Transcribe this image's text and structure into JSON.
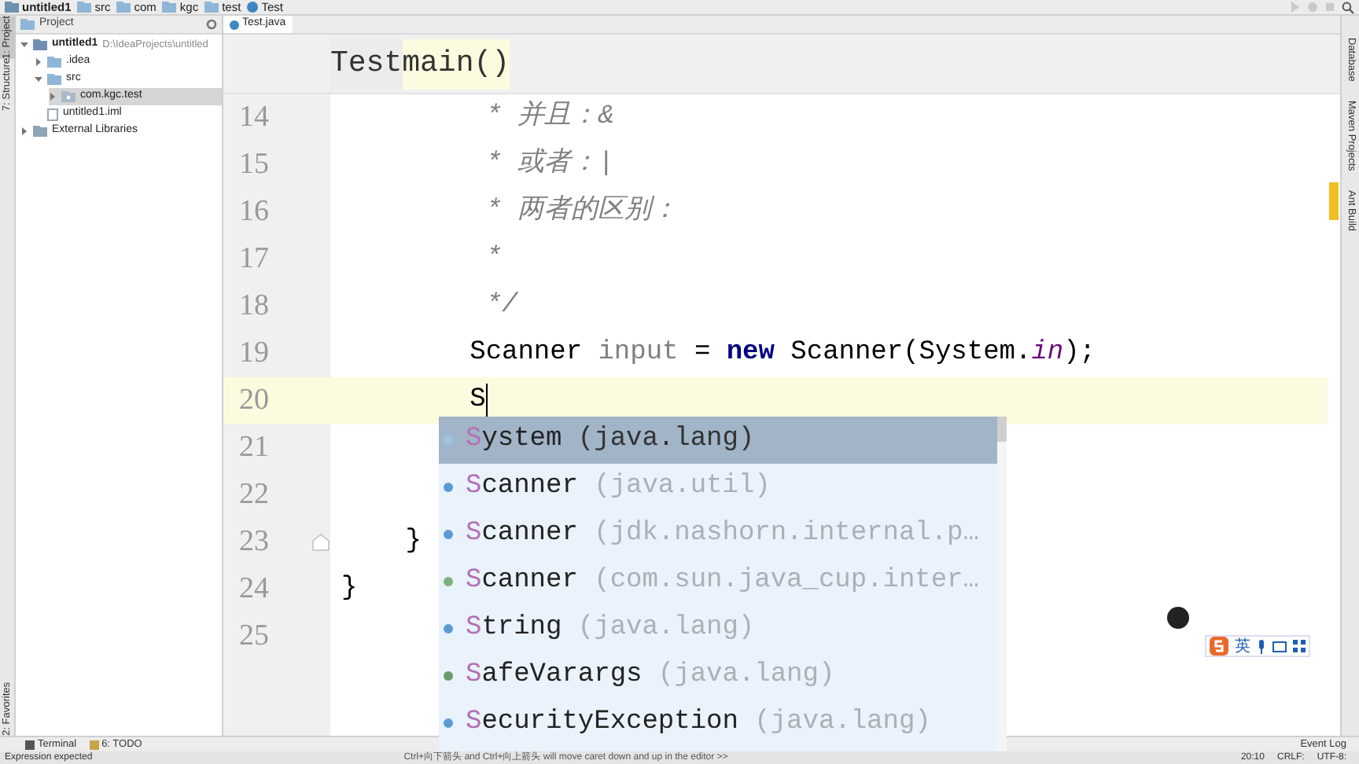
{
  "navbar": {
    "crumbs": [
      {
        "label": "untitled1",
        "kind": "project"
      },
      {
        "label": "src",
        "kind": "folder"
      },
      {
        "label": "com",
        "kind": "folder"
      },
      {
        "label": "kgc",
        "kind": "folder"
      },
      {
        "label": "test",
        "kind": "folder"
      },
      {
        "label": "Test",
        "kind": "class"
      }
    ]
  },
  "left_strip": [
    {
      "label": "1: Project",
      "selected": true
    },
    {
      "label": "7: Structure",
      "selected": false
    }
  ],
  "left_strip_bottom": [
    {
      "label": "2: Favorites",
      "selected": false
    }
  ],
  "project_panel": {
    "title": "Project",
    "tree": [
      {
        "label": "untitled1",
        "path": "D:\\IdeaProjects\\untitled",
        "kind": "module",
        "expanded": true,
        "selected": false,
        "children": [
          {
            "label": ".idea",
            "kind": "folder",
            "expanded": false,
            "selected": false
          },
          {
            "label": "src",
            "kind": "folder",
            "expanded": true,
            "selected": false,
            "children": [
              {
                "label": "com.kgc.test",
                "kind": "package",
                "expanded": false,
                "selected": true
              }
            ]
          },
          {
            "label": "untitled1.iml",
            "kind": "file",
            "selected": false
          }
        ]
      },
      {
        "label": "External Libraries",
        "kind": "library",
        "expanded": false,
        "selected": false
      }
    ]
  },
  "editor": {
    "tab": "Test.java",
    "breadcrumb": [
      {
        "label": "Test",
        "selected": false
      },
      {
        "label": "main()",
        "selected": true
      }
    ],
    "lines": [
      {
        "number": "14",
        "current": false,
        "tokens": [
          {
            "text": "         * 并且：&",
            "kind": "comment"
          }
        ]
      },
      {
        "number": "15",
        "current": false,
        "tokens": [
          {
            "text": "         * 或者：|",
            "kind": "comment"
          }
        ]
      },
      {
        "number": "16",
        "current": false,
        "tokens": [
          {
            "text": "         * 两者的区别：",
            "kind": "comment"
          }
        ]
      },
      {
        "number": "17",
        "current": false,
        "tokens": [
          {
            "text": "         *",
            "kind": "comment"
          }
        ]
      },
      {
        "number": "18",
        "current": false,
        "tokens": [
          {
            "text": "         */",
            "kind": "comment"
          }
        ]
      },
      {
        "number": "19",
        "current": false,
        "tokens": [
          {
            "text": "        Scanner ",
            "kind": "plain"
          },
          {
            "text": "input",
            "kind": "unused"
          },
          {
            "text": " = ",
            "kind": "plain"
          },
          {
            "text": "new",
            "kind": "keyword"
          },
          {
            "text": " Scanner(System.",
            "kind": "plain"
          },
          {
            "text": "in",
            "kind": "field"
          },
          {
            "text": ");",
            "kind": "plain"
          }
        ]
      },
      {
        "number": "20",
        "current": true,
        "tokens": [
          {
            "text": "        S",
            "kind": "plain"
          }
        ]
      },
      {
        "number": "21",
        "current": false
      },
      {
        "number": "22",
        "current": false
      },
      {
        "number": "23",
        "current": false,
        "fold": true,
        "tokens": [
          {
            "text": "    }",
            "kind": "plain"
          }
        ]
      },
      {
        "number": "24",
        "current": false,
        "tokens": [
          {
            "text": "}",
            "kind": "plain"
          }
        ]
      },
      {
        "number": "25",
        "current": false
      }
    ]
  },
  "completion": [
    {
      "match": "S",
      "rest": "ystem",
      "package": "(java.lang)",
      "color": "#9fc3e0",
      "selected": true
    },
    {
      "match": "S",
      "rest": "canner",
      "package": "(java.util)",
      "color": "#5b9bd5",
      "selected": false
    },
    {
      "match": "S",
      "rest": "canner",
      "package": "(jdk.nashorn.internal.p…",
      "color": "#5b9bd5",
      "selected": false
    },
    {
      "match": "S",
      "rest": "canner",
      "package": "(com.sun.java_cup.inter…",
      "color": "#7fb17f",
      "selected": false
    },
    {
      "match": "S",
      "rest": "tring",
      "package": "(java.lang)",
      "color": "#5b9bd5",
      "selected": false
    },
    {
      "match": "S",
      "rest": "afeVarargs",
      "package": "(java.lang)",
      "color": "#6a9a6a",
      "selected": false
    },
    {
      "match": "S",
      "rest": "ecurityException",
      "package": "(java.lang)",
      "color": "#5b9bd5",
      "selected": false
    }
  ],
  "ime": {
    "mode": "英"
  },
  "right_strip": [
    {
      "label": "Database"
    },
    {
      "label": "Maven Projects"
    },
    {
      "label": "Ant Build"
    }
  ],
  "bottom_tools": [
    {
      "label": "Terminal",
      "kind": "terminal"
    },
    {
      "label": "6: TODO",
      "kind": "todo"
    }
  ],
  "event_log": "Event Log",
  "status_bar": {
    "message": "Expression expected",
    "hint": "Ctrl+向下箭头 and Ctrl+向上箭头 will move caret down and up in the editor >>",
    "position": "20:10",
    "line_separator": "CRLF:",
    "encoding": "UTF-8:"
  }
}
